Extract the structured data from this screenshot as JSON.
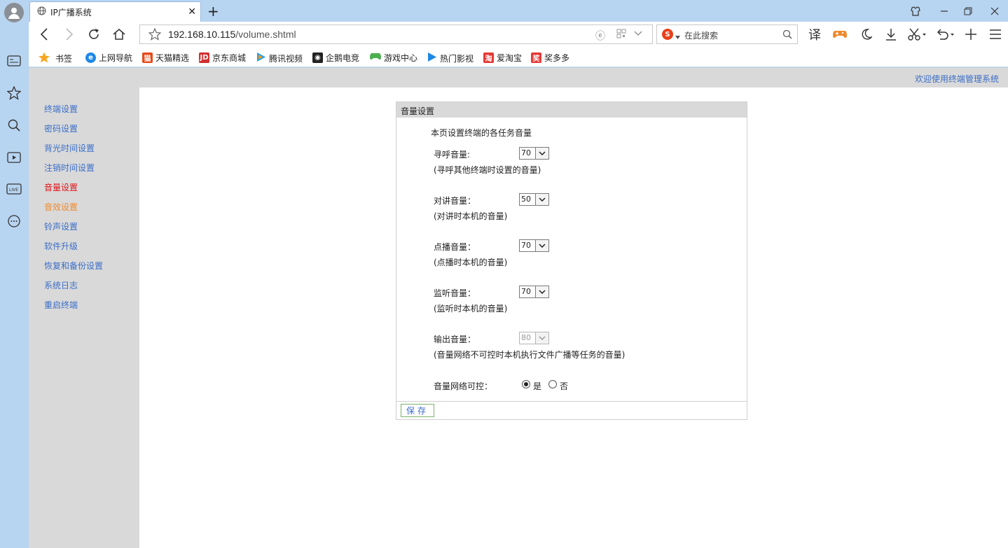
{
  "browser": {
    "tab_title": "IP广播系统",
    "url_host": "192.168.10.115",
    "url_path": "/volume.shtml",
    "search_placeholder": "在此搜索",
    "translate_label": "译"
  },
  "bookmarks": [
    {
      "label": "书签",
      "icon": "star-icon",
      "color": "#f5a623"
    },
    {
      "label": "上网导航",
      "icon": "ie-icon",
      "color": "#1e88e5"
    },
    {
      "label": "天猫精选",
      "icon": "tmall-icon",
      "color": "#e64a19"
    },
    {
      "label": "京东商城",
      "icon": "jd-icon",
      "color": "#d32f2f"
    },
    {
      "label": "腾讯视频",
      "icon": "tencent-video-icon",
      "color": "#20a0ff"
    },
    {
      "label": "企鹅电竞",
      "icon": "penguin-icon",
      "color": "#222222"
    },
    {
      "label": "游戏中心",
      "icon": "game-icon",
      "color": "#4caf50"
    },
    {
      "label": "热门影视",
      "icon": "play-icon",
      "color": "#1e88e5"
    },
    {
      "label": "爱淘宝",
      "icon": "taobao-icon",
      "color": "#e53935"
    },
    {
      "label": "奖多多",
      "icon": "prize-icon",
      "color": "#e53935"
    }
  ],
  "header": {
    "welcome": "欢迎使用终端管理系统"
  },
  "sidebar": {
    "items": [
      {
        "label": "终端设置"
      },
      {
        "label": "密码设置"
      },
      {
        "label": "背光时间设置"
      },
      {
        "label": "注销时间设置"
      },
      {
        "label": "音量设置"
      },
      {
        "label": "音效设置"
      },
      {
        "label": "铃声设置"
      },
      {
        "label": "软件升级"
      },
      {
        "label": "恢复和备份设置"
      },
      {
        "label": "系统日志"
      },
      {
        "label": "重启终端"
      }
    ]
  },
  "panel": {
    "title": "音量设置",
    "intro": "本页设置终端的各任务音量",
    "fields": [
      {
        "label": "寻呼音量:",
        "value": "70",
        "note": "(寻呼其他终端时设置的音量)",
        "disabled": false
      },
      {
        "label": "对讲音量：",
        "value": "50",
        "note": "(对讲时本机的音量)",
        "disabled": false
      },
      {
        "label": "点播音量：",
        "value": "70",
        "note": "(点播时本机的音量)",
        "disabled": false
      },
      {
        "label": "监听音量：",
        "value": "70",
        "note": "(监听时本机的音量)",
        "disabled": false
      },
      {
        "label": "输出音量：",
        "value": "80",
        "note": "(音量网络不可控时本机执行文件广播等任务的音量)",
        "disabled": true
      }
    ],
    "network": {
      "label": "音量网络可控：",
      "yes": "是",
      "no": "否",
      "selected": "yes"
    },
    "save_label": "保存"
  }
}
